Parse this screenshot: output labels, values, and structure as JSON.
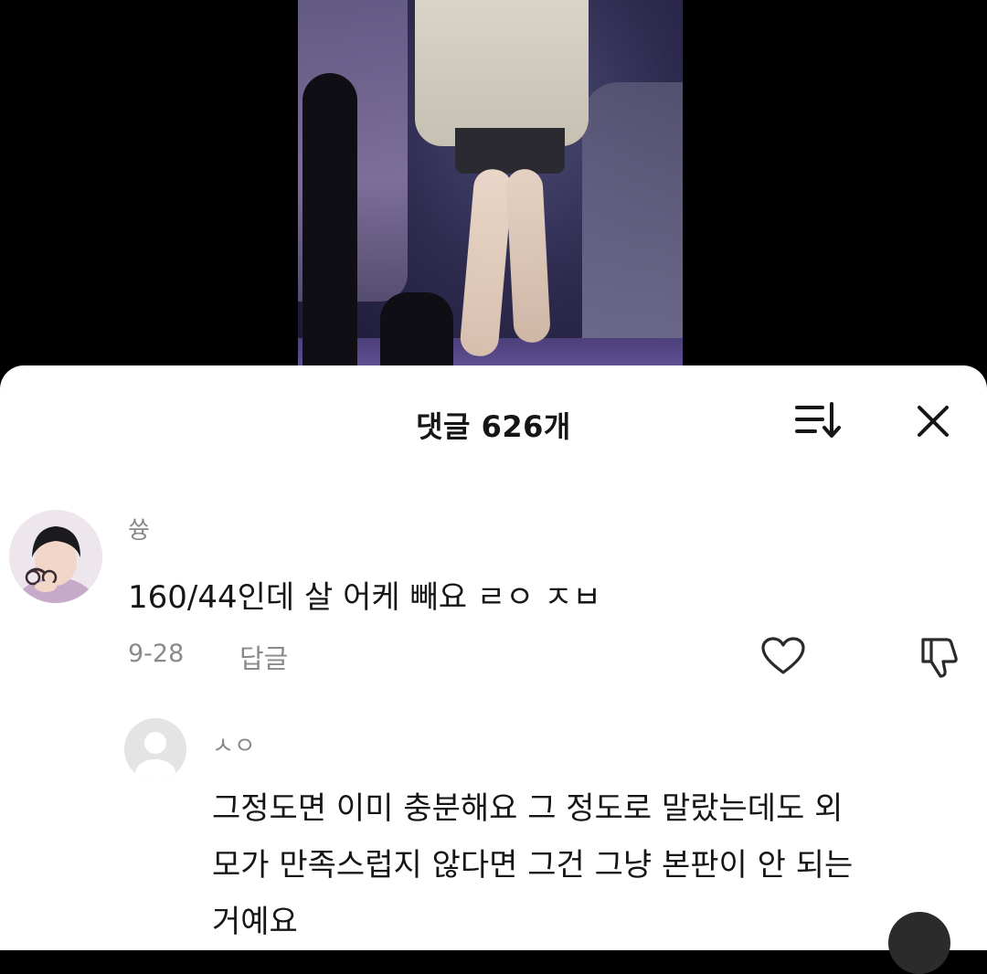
{
  "sheet": {
    "title": "댓글 626개",
    "sort_icon": "sort-icon",
    "close_icon": "close-icon"
  },
  "comments": [
    {
      "username": "쓩",
      "text": "160/44인데 살 어케 빼요 ㄹㅇ ㅈㅂ",
      "date": "9-28",
      "reply_label": "답글",
      "like_icon": "heart-icon",
      "dislike_icon": "thumbs-down-icon",
      "replies": [
        {
          "username": "ㅅㅇ",
          "text_lines": [
            "그정도면 이미 충분해요 그 정도로 말랐는데도 외",
            "모가 만족스럽지 않다면 그건 그냥 본판이 안 되는",
            "거예요"
          ]
        }
      ]
    }
  ]
}
